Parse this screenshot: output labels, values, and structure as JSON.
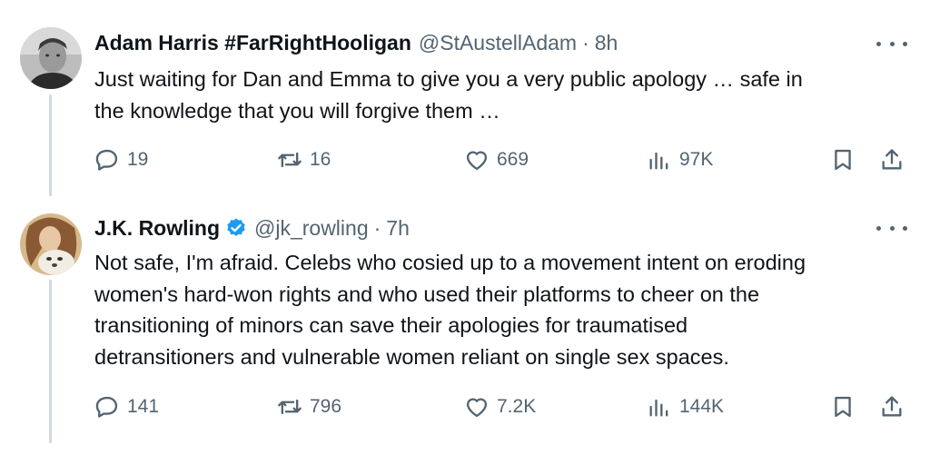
{
  "tweets": [
    {
      "author": {
        "name": "Adam Harris #FarRightHooligan",
        "handle": "@StAustellAdam",
        "separator": "·",
        "time": "8h",
        "verified": false
      },
      "text_lines": [
        "Just waiting for Dan and Emma to give you a very public apology … safe in",
        "the knowledge that you will forgive them …"
      ],
      "stats": {
        "replies": "19",
        "retweets": "16",
        "likes": "669",
        "views": "97K"
      }
    },
    {
      "author": {
        "name": "J.K. Rowling",
        "handle": "@jk_rowling",
        "separator": "·",
        "time": "7h",
        "verified": true
      },
      "text_lines": [
        "Not safe, I'm afraid. Celebs who cosied up to a movement intent on eroding",
        "women's hard-won rights and who used their platforms to cheer on the",
        "transitioning of minors can save their apologies for traumatised",
        "detransitioners and vulnerable women reliant on single sex spaces."
      ],
      "stats": {
        "replies": "141",
        "retweets": "796",
        "likes": "7.2K",
        "views": "144K"
      }
    }
  ],
  "icons": {
    "reply": "reply-icon",
    "retweet": "retweet-icon",
    "like": "heart-icon",
    "views": "views-icon",
    "bookmark": "bookmark-icon",
    "share": "share-icon",
    "more": "more-icon",
    "verified": "verified-badge-icon"
  },
  "colors": {
    "text": "#0f1419",
    "secondary": "#536471",
    "verified": "#1d9bf0",
    "thread_line": "#cfd9de"
  }
}
